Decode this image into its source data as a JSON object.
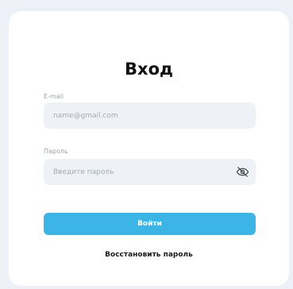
{
  "login": {
    "title": "Вход",
    "email_label": "E-mail",
    "email_placeholder": "name@gmail.com",
    "password_label": "Пароль",
    "password_placeholder": "Введите пароль",
    "password_toggle_icon": "eye-slash-icon",
    "submit_label": "Войти",
    "restore_label": "Восстановить пароль"
  },
  "colors": {
    "accent": "#3db4e6",
    "field_bg": "#eef1f5",
    "page_bg": "#edf1f7"
  }
}
